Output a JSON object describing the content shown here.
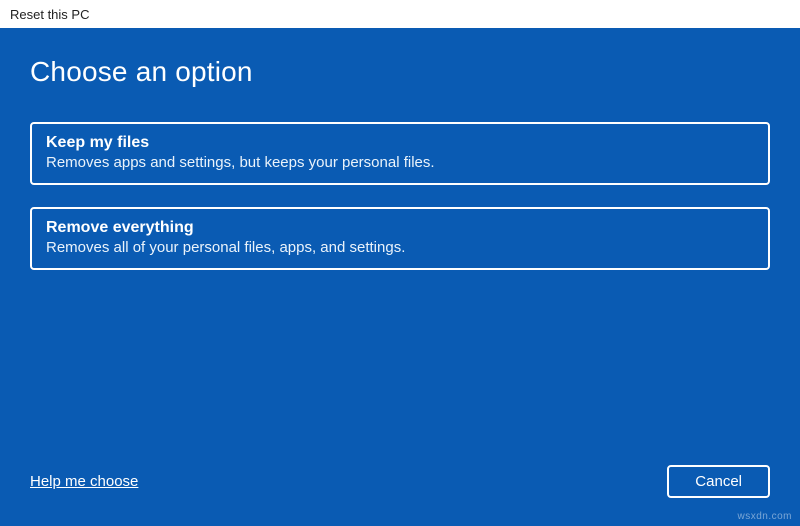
{
  "window": {
    "title": "Reset this PC"
  },
  "main": {
    "heading": "Choose an option",
    "options": [
      {
        "title": "Keep my files",
        "description": "Removes apps and settings, but keeps your personal files."
      },
      {
        "title": "Remove everything",
        "description": "Removes all of your personal files, apps, and settings."
      }
    ]
  },
  "footer": {
    "help_link": "Help me choose",
    "cancel_label": "Cancel"
  },
  "watermark": "wsxdn.com"
}
